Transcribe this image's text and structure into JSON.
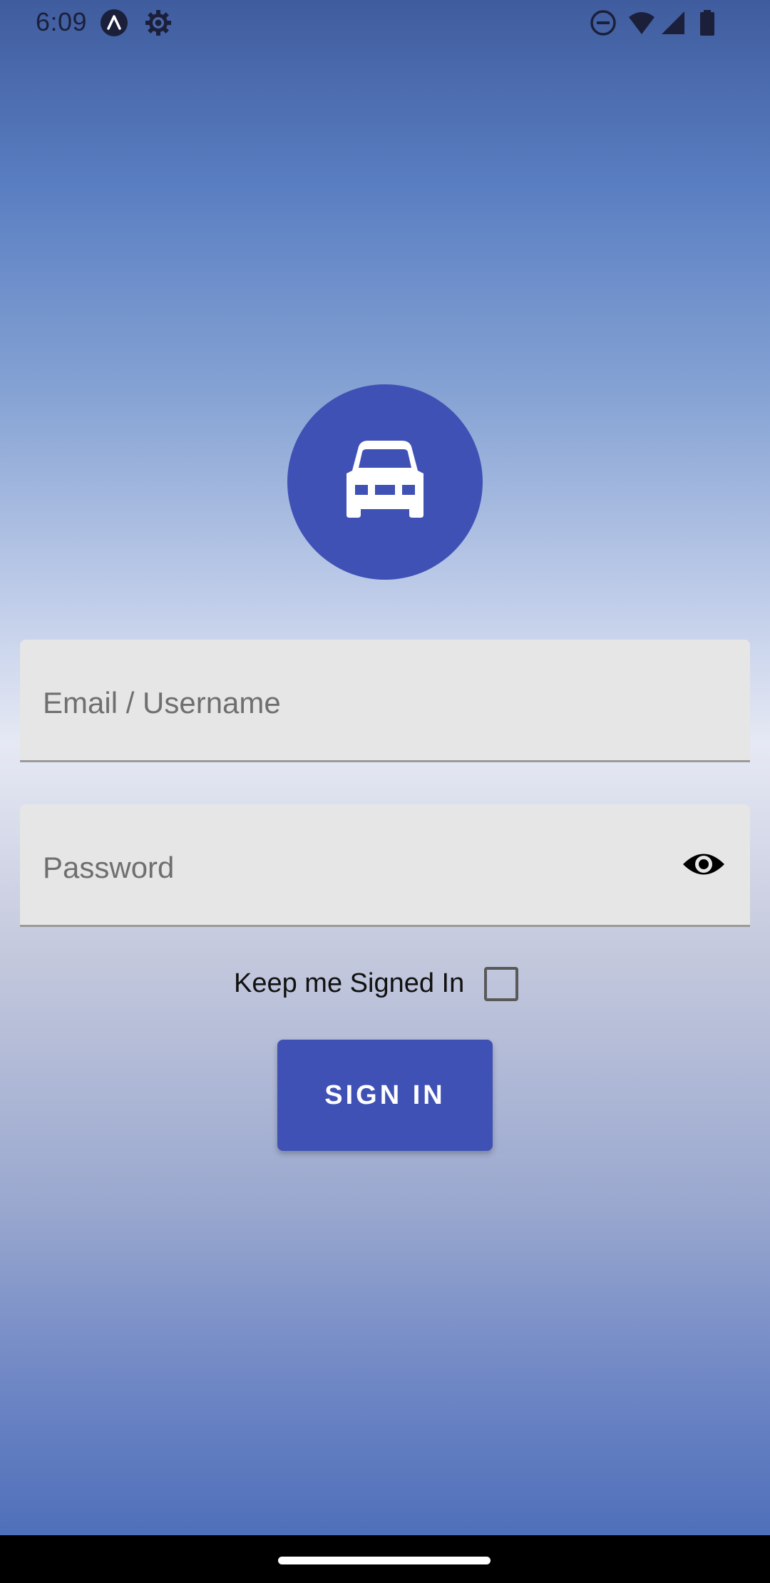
{
  "status_bar": {
    "time": "6:09",
    "left_icons": [
      "android-assistant-icon",
      "settings-gear-icon"
    ],
    "right_icons": [
      "do-not-disturb-icon",
      "wifi-icon",
      "cellular-signal-icon",
      "battery-icon"
    ]
  },
  "logo": {
    "icon": "car-icon",
    "color": "#3f51b5"
  },
  "login_form": {
    "email_placeholder": "Email / Username",
    "email_value": "",
    "password_placeholder": "Password",
    "password_value": "",
    "password_toggle_icon": "eye-icon",
    "keep_signed_in_label": "Keep me Signed In",
    "keep_signed_in_checked": false,
    "sign_in_label": "SIGN IN"
  },
  "colors": {
    "accent": "#3f51b5",
    "field_background": "#e6e6e6"
  }
}
